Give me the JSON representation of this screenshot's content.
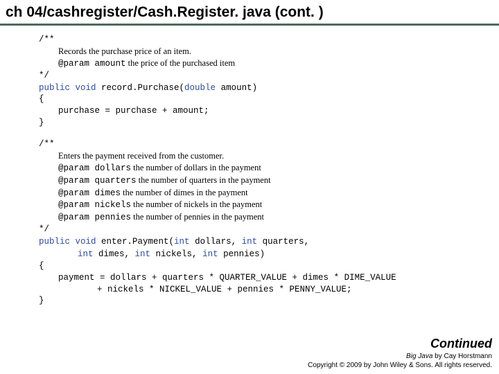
{
  "title": "ch 04/cashregister/Cash.Register. java (cont. )",
  "code": {
    "b1_open": "/**",
    "b1_desc": "Records the purchase price of an item.",
    "b1_param_kw": "@param amount",
    "b1_param_txt": " the price of the purchased item",
    "b1_close": "*/",
    "b1_sig_1": "public void",
    "b1_sig_2": " record.Purchase(",
    "b1_sig_3": "double",
    "b1_sig_4": " amount)",
    "brace_open": "{",
    "b1_body": "purchase = purchase + amount;",
    "brace_close": "}",
    "b2_open": "/**",
    "b2_desc": "Enters the payment received from the customer.",
    "b2_p1_kw": "@param dollars",
    "b2_p1_txt": " the number of dollars in the payment",
    "b2_p2_kw": "@param quarters",
    "b2_p2_txt": " the number of quarters in the payment",
    "b2_p3_kw": "@param dimes",
    "b2_p3_txt": " the number of dimes in the payment",
    "b2_p4_kw": "@param nickels",
    "b2_p4_txt": " the number of nickels in the payment",
    "b2_p5_kw": "@param pennies",
    "b2_p5_txt": " the number of pennies in the payment",
    "b2_close": "*/",
    "b2_sig_1": "public void",
    "b2_sig_2": " enter.Payment(",
    "b2_sig_3": "int",
    "b2_sig_4": " dollars, ",
    "b2_sig_5": "int",
    "b2_sig_6": " quarters,",
    "b2_sig2_1": "int",
    "b2_sig2_2": " dimes, ",
    "b2_sig2_3": "int",
    "b2_sig2_4": " nickels, ",
    "b2_sig2_5": "int",
    "b2_sig2_6": " pennies)",
    "b2_body1": "payment = dollars + quarters * QUARTER_VALUE + dimes * DIME_VALUE",
    "b2_body2": "+ nickels * NICKEL_VALUE + pennies * PENNY_VALUE;"
  },
  "footer": {
    "continued": "Continued",
    "book": "Big Java",
    "by": " by Cay Horstmann",
    "copy": "Copyright © 2009 by John Wiley & Sons. All rights reserved."
  }
}
